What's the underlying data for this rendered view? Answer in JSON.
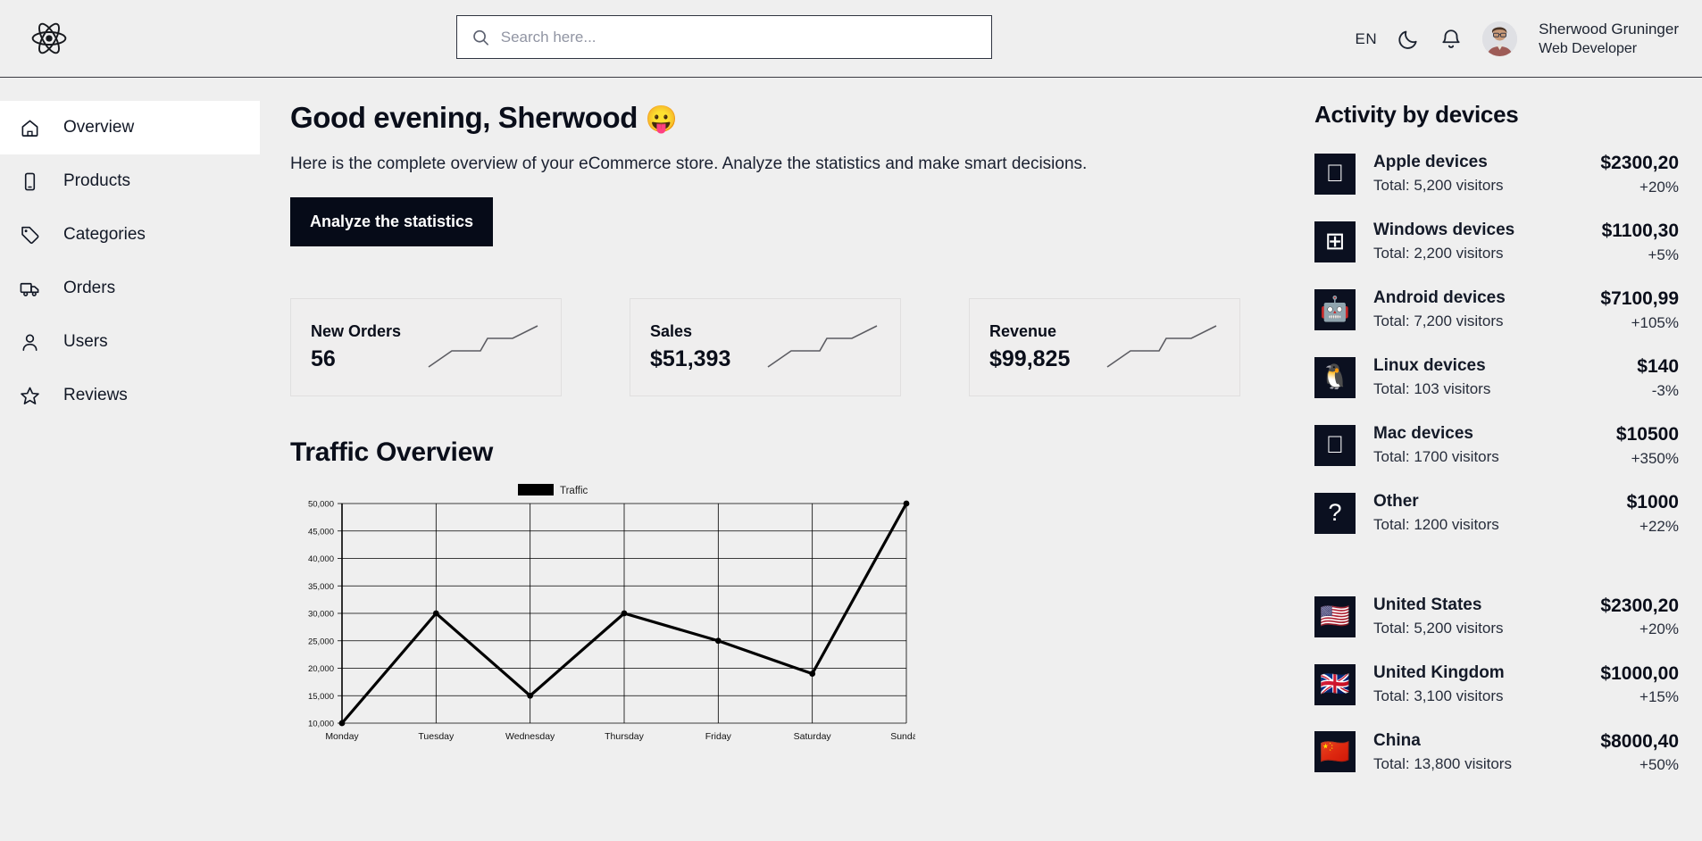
{
  "header": {
    "logo_icon": "react-atom-logo",
    "search": {
      "placeholder": "Search here...",
      "value": ""
    },
    "language": "EN",
    "dark_mode_icon": "moon-icon",
    "notifications_icon": "bell-icon",
    "user": {
      "name": "Sherwood Gruninger",
      "role": "Web Developer"
    }
  },
  "sidebar": {
    "items": [
      {
        "label": "Overview",
        "icon": "home-icon",
        "active": true
      },
      {
        "label": "Products",
        "icon": "mobile-icon",
        "active": false
      },
      {
        "label": "Categories",
        "icon": "tag-icon",
        "active": false
      },
      {
        "label": "Orders",
        "icon": "truck-icon",
        "active": false
      },
      {
        "label": "Users",
        "icon": "user-icon",
        "active": false
      },
      {
        "label": "Reviews",
        "icon": "star-icon",
        "active": false
      }
    ]
  },
  "main": {
    "greeting": "Good evening, Sherwood",
    "greeting_emoji": "😛",
    "subtitle": "Here is the complete overview of your eCommerce store. Analyze the statistics and make smart decisions.",
    "cta_label": "Analyze the statistics",
    "cards": [
      {
        "label": "New Orders",
        "value": "56"
      },
      {
        "label": "Sales",
        "value": "$51,393"
      },
      {
        "label": "Revenue",
        "value": "$99,825"
      }
    ],
    "section_title": "Traffic Overview"
  },
  "chart_data": {
    "type": "line",
    "title": "Traffic Overview",
    "legend": [
      "Traffic"
    ],
    "legend_position": "top-center",
    "categories": [
      "Monday",
      "Tuesday",
      "Wednesday",
      "Thursday",
      "Friday",
      "Saturday",
      "Sunday"
    ],
    "series": [
      {
        "name": "Traffic",
        "values": [
          10000,
          30000,
          15000,
          30000,
          25000,
          19000,
          50000
        ],
        "color": "#000000"
      }
    ],
    "ytick_labels": [
      "10,000",
      "15,000",
      "20,000",
      "25,000",
      "30,000",
      "35,000",
      "40,000",
      "45,000",
      "50,000"
    ],
    "yticks": [
      10000,
      15000,
      20000,
      25000,
      30000,
      35000,
      40000,
      45000,
      50000
    ],
    "ylim": [
      10000,
      50000
    ],
    "xlabel": "",
    "ylabel": "",
    "grid": true
  },
  "right_panel": {
    "title": "Activity by devices",
    "devices": [
      {
        "name": "Apple devices",
        "sub": "Total: 5,200 visitors",
        "amount": "$2300,20",
        "delta": "+20%",
        "icon": "apple-icon",
        "glyph": ""
      },
      {
        "name": "Windows devices",
        "sub": "Total: 2,200 visitors",
        "amount": "$1100,30",
        "delta": "+5%",
        "icon": "windows-icon",
        "glyph": "⊞"
      },
      {
        "name": "Android devices",
        "sub": "Total: 7,200 visitors",
        "amount": "$7100,99",
        "delta": "+105%",
        "icon": "android-icon",
        "glyph": "🤖"
      },
      {
        "name": "Linux devices",
        "sub": "Total: 103 visitors",
        "amount": "$140",
        "delta": "-3%",
        "icon": "linux-icon",
        "glyph": "🐧"
      },
      {
        "name": "Mac devices",
        "sub": "Total: 1700 visitors",
        "amount": "$10500",
        "delta": "+350%",
        "icon": "apple-icon",
        "glyph": ""
      },
      {
        "name": "Other",
        "sub": "Total: 1200 visitors",
        "amount": "$1000",
        "delta": "+22%",
        "icon": "question-icon",
        "glyph": "?"
      }
    ],
    "countries": [
      {
        "name": "United States",
        "sub": "Total: 5,200 visitors",
        "amount": "$2300,20",
        "delta": "+20%",
        "icon": "flag-us-icon",
        "glyph": "🇺🇸"
      },
      {
        "name": "United Kingdom",
        "sub": "Total: 3,100 visitors",
        "amount": "$1000,00",
        "delta": "+15%",
        "icon": "flag-gb-icon",
        "glyph": "🇬🇧"
      },
      {
        "name": "China",
        "sub": "Total: 13,800 visitors",
        "amount": "$8000,40",
        "delta": "+50%",
        "icon": "flag-cn-icon",
        "glyph": "🇨🇳"
      }
    ]
  }
}
